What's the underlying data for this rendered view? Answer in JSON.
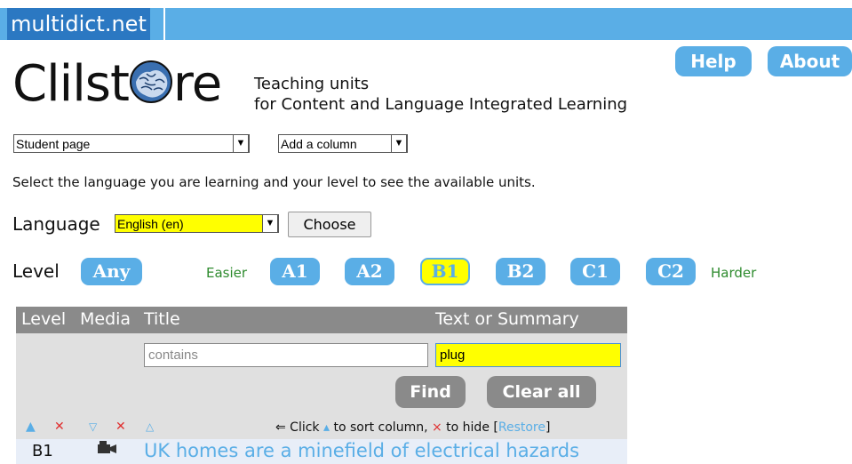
{
  "topbar": {
    "brand": "multidict.net"
  },
  "header": {
    "logo_prefix": "Clilst",
    "logo_suffix": "re",
    "tagline_line1": "Teaching units",
    "tagline_line2": "for Content and Language Integrated Learning",
    "help_label": "Help",
    "about_label": "About"
  },
  "controls": {
    "page_select": "Student page",
    "column_select": "Add a column",
    "instructions": "Select the language you are learning and your level to see the available units.",
    "language_label": "Language",
    "language_value": "English (en)",
    "choose_label": "Choose",
    "level_label": "Level",
    "levels": [
      "Any",
      "A1",
      "A2",
      "B1",
      "B2",
      "C1",
      "C2"
    ],
    "selected_level": "B1",
    "easier": "Easier",
    "harder": "Harder"
  },
  "table": {
    "headers": {
      "level": "Level",
      "media": "Media",
      "title": "Title",
      "text": "Text or Summary"
    },
    "title_placeholder": "contains",
    "text_filter": "plug",
    "find_label": "Find",
    "clear_label": "Clear all",
    "hint_prefix": "⇐ Click ",
    "hint_middle": " to sort column, ",
    "hint_suffix": " to hide [",
    "restore_label": "Restore",
    "hint_end": "]",
    "rows": [
      {
        "level": "B1",
        "media": "video-icon",
        "title": "UK homes are a minefield of electrical hazards"
      }
    ]
  },
  "colors": {
    "accent": "#5aaee6",
    "highlight": "#ffff00",
    "header_gray": "#8a8a8a",
    "easier_harder": "#2e8b2e"
  }
}
